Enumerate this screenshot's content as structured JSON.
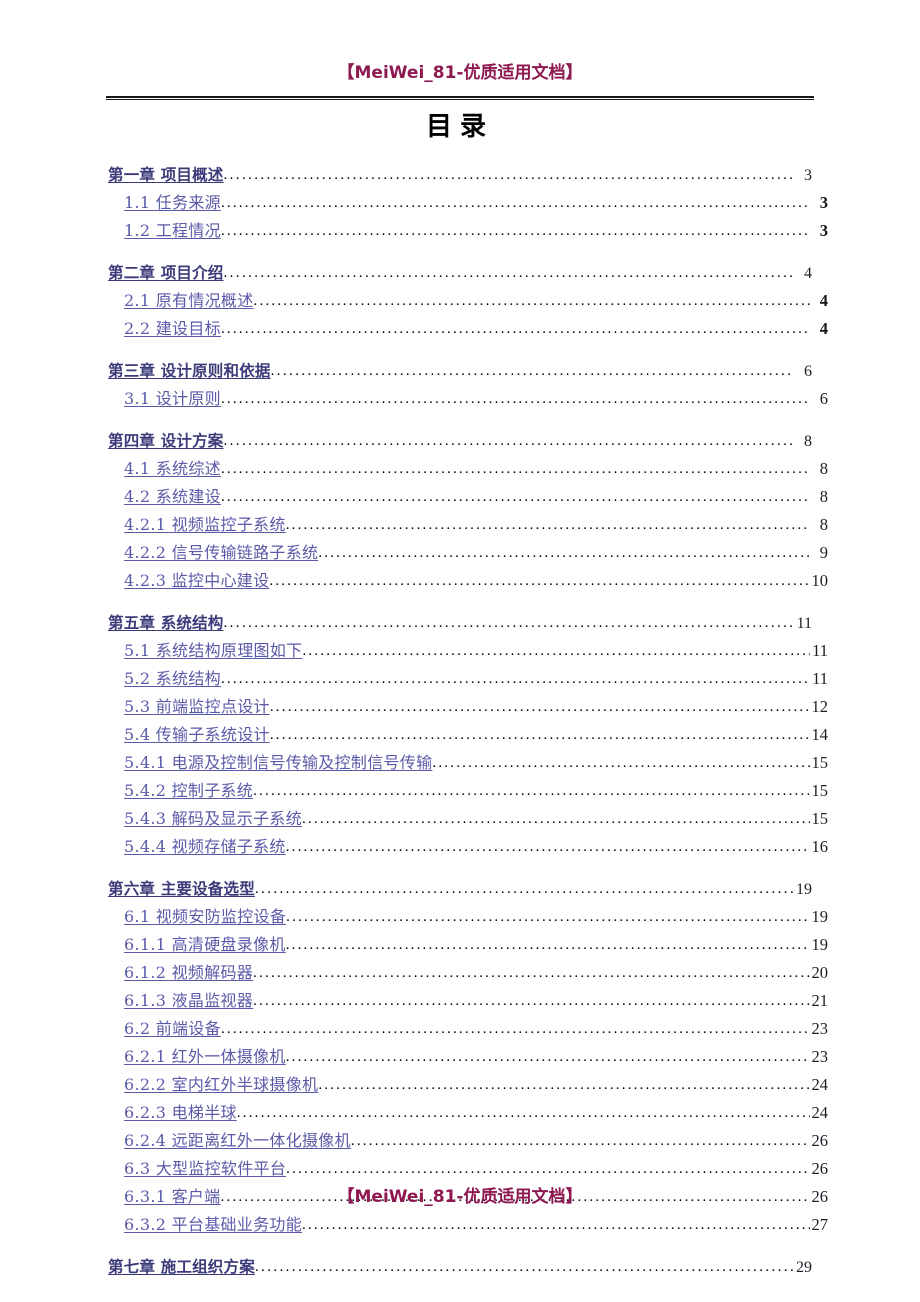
{
  "header": {
    "watermark": "【MeiWei_81-优质适用文档】"
  },
  "title": "目录",
  "footer": {
    "watermark": "【MeiWei_81-优质适用文档】"
  },
  "colors": {
    "watermark": "#8E1850",
    "level1_text": "#3B3B7A",
    "level2_text": "#5A5AA8",
    "page_number": "#000000",
    "rule": "#1A1A1A",
    "title": "#000000"
  },
  "toc": {
    "entries": [
      {
        "level": 1,
        "label": "第一章  项目概述",
        "page": "3",
        "bold_page": false
      },
      {
        "level": 2,
        "label": "1.1 任务来源",
        "page": "3",
        "bold_page": true
      },
      {
        "level": 2,
        "label": "1.2 工程情况",
        "page": "3",
        "bold_page": true
      },
      {
        "level": 1,
        "label": "第二章  项目介绍",
        "page": "4",
        "bold_page": false
      },
      {
        "level": 2,
        "label": "2.1  原有情况概述",
        "page": "4",
        "bold_page": true
      },
      {
        "level": 2,
        "label": "2.2  建设目标",
        "page": "4",
        "bold_page": true
      },
      {
        "level": 1,
        "label": "第三章  设计原则和依据",
        "page": "6",
        "bold_page": false
      },
      {
        "level": 2,
        "label": "3.1   设计原则",
        "page": "6",
        "bold_page": false
      },
      {
        "level": 1,
        "label": "第四章  设计方案",
        "page": "8",
        "bold_page": false
      },
      {
        "level": 2,
        "label": "4.1   系统综述",
        "page": "8",
        "bold_page": false
      },
      {
        "level": 2,
        "label": "4.2   系统建设",
        "page": "8",
        "bold_page": false
      },
      {
        "level": 2,
        "label": "4.2.1 视频监控子系统",
        "page": "8",
        "bold_page": false
      },
      {
        "level": 2,
        "label": "4.2.2 信号传输链路子系统",
        "page": "9",
        "bold_page": false
      },
      {
        "level": 2,
        "label": "4.2.3 监控中心建设",
        "page": "10",
        "bold_page": false
      },
      {
        "level": 1,
        "label": "第五章  系统结构",
        "page": "11",
        "bold_page": false
      },
      {
        "level": 2,
        "label": "5.1   系统结构原理图如下",
        "page": "11",
        "bold_page": false
      },
      {
        "level": 2,
        "label": "5.2   系统结构",
        "page": "11",
        "bold_page": false
      },
      {
        "level": 2,
        "label": "5.3   前端监控点设计",
        "page": "12",
        "bold_page": false
      },
      {
        "level": 2,
        "label": "5.4   传输子系统设计",
        "page": "14",
        "bold_page": false
      },
      {
        "level": 2,
        "label": "5.4.1 电源及控制信号传输及控制信号传输",
        "page": "15",
        "bold_page": false
      },
      {
        "level": 2,
        "label": "5.4.2 控制子系统",
        "page": "15",
        "bold_page": false
      },
      {
        "level": 2,
        "label": "5.4.3 解码及显示子系统",
        "page": "15",
        "bold_page": false
      },
      {
        "level": 2,
        "label": "5.4.4 视频存储子系统",
        "page": "16",
        "bold_page": false
      },
      {
        "level": 1,
        "label": "第六章   主要设备选型",
        "page": "19",
        "bold_page": false
      },
      {
        "level": 2,
        "label": "6.1   视频安防监控设备",
        "page": "19",
        "bold_page": false
      },
      {
        "level": 2,
        "label": "6.1.1  高清硬盘录像机",
        "page": "19",
        "bold_page": false
      },
      {
        "level": 2,
        "label": "6.1.2  视频解码器",
        "page": "20",
        "bold_page": false
      },
      {
        "level": 2,
        "label": "6.1.3  液晶监视器",
        "page": "21",
        "bold_page": false
      },
      {
        "level": 2,
        "label": "6.2    前端设备",
        "page": "23",
        "bold_page": false
      },
      {
        "level": 2,
        "label": "6.2.1  红外一体摄像机",
        "page": "23",
        "bold_page": false
      },
      {
        "level": 2,
        "label": "6.2.2  室内红外半球摄像机",
        "page": "24",
        "bold_page": false
      },
      {
        "level": 2,
        "label": "6.2.3  电梯半球",
        "page": "24",
        "bold_page": false
      },
      {
        "level": 2,
        "label": "6.2.4  远距离红外一体化摄像机",
        "page": "26",
        "bold_page": false
      },
      {
        "level": 2,
        "label": "6.3   大型监控软件平台",
        "page": "26",
        "bold_page": false
      },
      {
        "level": 2,
        "label": "6.3.1  客户端",
        "page": "26",
        "bold_page": false
      },
      {
        "level": 2,
        "label": "6.3.2  平台基础业务功能",
        "page": "27",
        "bold_page": false
      },
      {
        "level": 1,
        "label": "第七章   施工组织方案",
        "page": "29",
        "bold_page": false
      }
    ],
    "leader_char": "."
  }
}
